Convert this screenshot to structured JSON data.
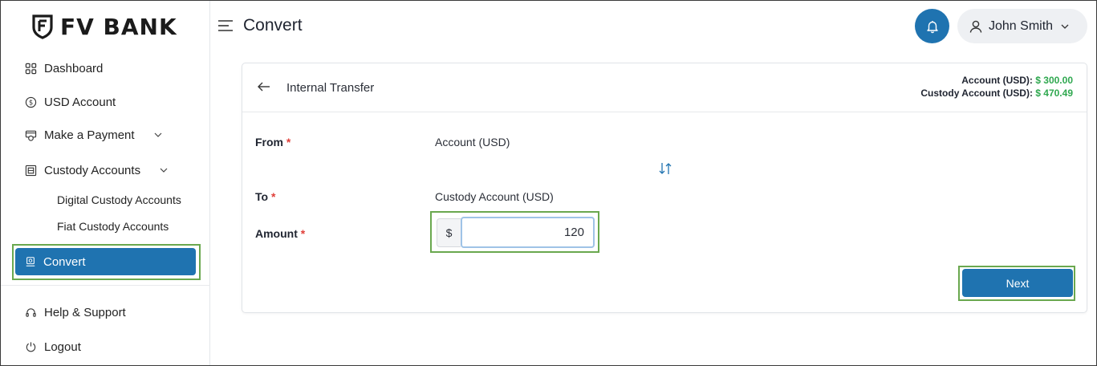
{
  "brand": {
    "name": "FV BANK",
    "accent": "#1f73b0",
    "highlight": "#6aa84f",
    "positive": "#2fa84f"
  },
  "sidebar": {
    "items": [
      {
        "label": "Dashboard",
        "icon": "grid-icon"
      },
      {
        "label": "USD Account",
        "icon": "dollar-coin-icon"
      },
      {
        "label": "Make a Payment",
        "icon": "payment-icon"
      },
      {
        "label": "Custody Accounts",
        "icon": "vault-icon"
      },
      {
        "label": "Convert",
        "icon": "convert-icon"
      },
      {
        "label": "Help & Support",
        "icon": "headset-icon"
      },
      {
        "label": "Logout",
        "icon": "power-icon"
      }
    ],
    "sub_items": [
      {
        "label": "Digital Custody Accounts"
      },
      {
        "label": "Fiat Custody Accounts"
      }
    ]
  },
  "header": {
    "title": "Convert",
    "user_name": "John Smith"
  },
  "card": {
    "title": "Internal Transfer",
    "balances": [
      {
        "label": "Account (USD):",
        "value": "$ 300.00"
      },
      {
        "label": "Custody Account (USD):",
        "value": "$ 470.49"
      }
    ],
    "form": {
      "from_label": "From",
      "from_value": "Account (USD)",
      "to_label": "To",
      "to_value": "Custody Account (USD)",
      "amount_label": "Amount",
      "required_mark": "*",
      "currency_prefix": "$",
      "amount_value": "120"
    },
    "next_label": "Next"
  }
}
